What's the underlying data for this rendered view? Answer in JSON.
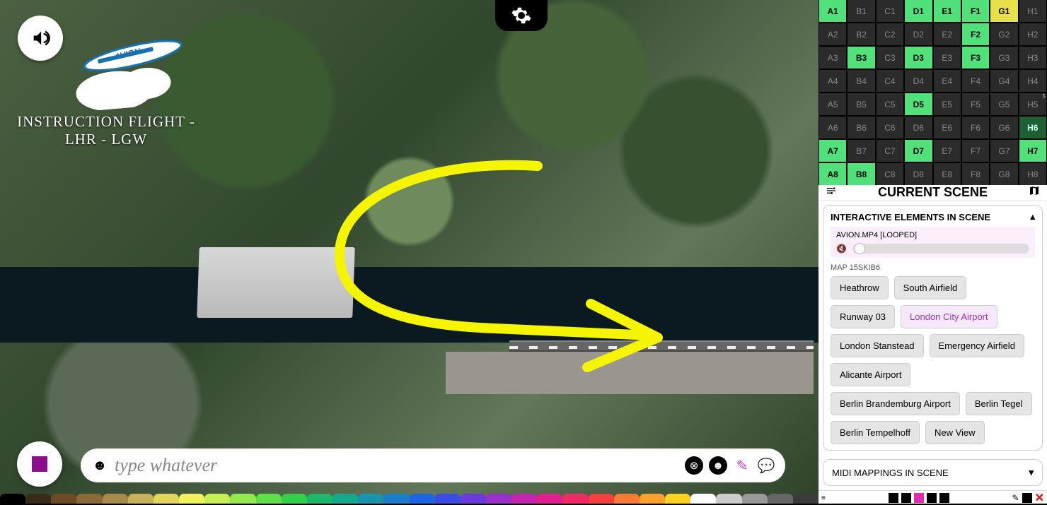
{
  "header": {
    "flight_title": "INSTRUCTION FLIGHT -",
    "flight_route": "LHR - LGW",
    "brand": "AVION"
  },
  "input": {
    "placeholder": "type whatever"
  },
  "scene": {
    "title": "CURRENT SCENE",
    "panel1_title": "INTERACTIVE ELEMENTS IN SCENE",
    "media_label": "AVION.MP4 [LOOPED]",
    "map_label": "MAP 15SKIB6",
    "tags": [
      "Heathrow",
      "South Airfield",
      "Runway 03",
      "London City Airport",
      "London Stanstead",
      "Emergency Airfield",
      "Alicante Airport",
      "Berlin Brandemburg Airport",
      "Berlin Tegel",
      "Berlin Tempelhoff",
      "New View"
    ],
    "active_tag_index": 3,
    "panel2_title": "MIDI MAPPINGS IN SCENE"
  },
  "grid": {
    "cols": [
      "A",
      "B",
      "C",
      "D",
      "E",
      "F",
      "G",
      "H"
    ],
    "rows": [
      1,
      2,
      3,
      4,
      5,
      6,
      7,
      8
    ],
    "active": [
      "A1",
      "D1",
      "E1",
      "F1",
      "F2",
      "B3",
      "D3",
      "F3",
      "D5",
      "A7",
      "D7",
      "H7",
      "A8",
      "B8"
    ],
    "dim": [
      "H6"
    ],
    "yellow": [
      "G1"
    ],
    "badge": {
      "H5": "5"
    }
  },
  "palette": [
    "#000000",
    "#3a2a1a",
    "#6b4a24",
    "#8a6a3a",
    "#a88a4a",
    "#c7b05a",
    "#e1d65b",
    "#f2f25c",
    "#c8ef55",
    "#94e94e",
    "#5fe04a",
    "#34d04b",
    "#1db86a",
    "#17a98e",
    "#1894ad",
    "#1a7ecb",
    "#1c66e4",
    "#3d4be6",
    "#6a3bdc",
    "#9a30ca",
    "#c625b0",
    "#e21f8e",
    "#ef2a66",
    "#f64040",
    "#f97a36",
    "#fca22c",
    "#ffd221",
    "#ffffff",
    "#cccccc",
    "#999999",
    "#666666",
    "#3b3b3b"
  ]
}
